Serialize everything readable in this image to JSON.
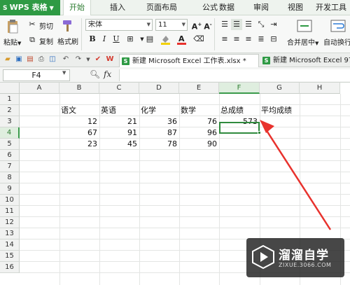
{
  "app": {
    "name": "WPS 表格"
  },
  "menu_tabs": [
    "开始",
    "插入",
    "页面布局",
    "公式",
    "数据",
    "审阅",
    "视图",
    "开发工具"
  ],
  "ribbon": {
    "paste_label": "粘贴",
    "cut_label": "剪切",
    "copy_label": "复制",
    "format_painter_label": "格式刷",
    "font_name": "宋体",
    "font_size": "11",
    "merge_center_label": "合并居中",
    "auto_wrap_label": "自动换行"
  },
  "doc_tabs": [
    "新建 Microsoft Excel 工作表.xlsx *",
    "新建 Microsoft Excel 97-"
  ],
  "formula_bar": {
    "name_box": "F4",
    "fx": "fx",
    "formula": ""
  },
  "grid": {
    "columns": [
      "A",
      "B",
      "C",
      "D",
      "E",
      "F",
      "G",
      "H"
    ],
    "rows": [
      "1",
      "2",
      "3",
      "4",
      "5",
      "6",
      "7",
      "8",
      "9",
      "10",
      "11",
      "12",
      "13",
      "14",
      "15",
      "16"
    ],
    "selected_column": "F",
    "selected_row": "4",
    "headers": [
      "语文",
      "英语",
      "化学",
      "数学",
      "总成绩",
      "平均成绩"
    ],
    "data": [
      [
        "12",
        "21",
        "36",
        "76",
        "573"
      ],
      [
        "67",
        "91",
        "87",
        "96",
        ""
      ],
      [
        "23",
        "45",
        "78",
        "90",
        ""
      ]
    ]
  },
  "annotation": {
    "arrow_color": "#e8322d"
  },
  "watermark": {
    "title": "溜溜自学",
    "url": "ZIXUE.3066.COM"
  },
  "colors": {
    "brand": "#2e9a44",
    "accent": "#2e7d32",
    "arrow": "#e8322d"
  }
}
